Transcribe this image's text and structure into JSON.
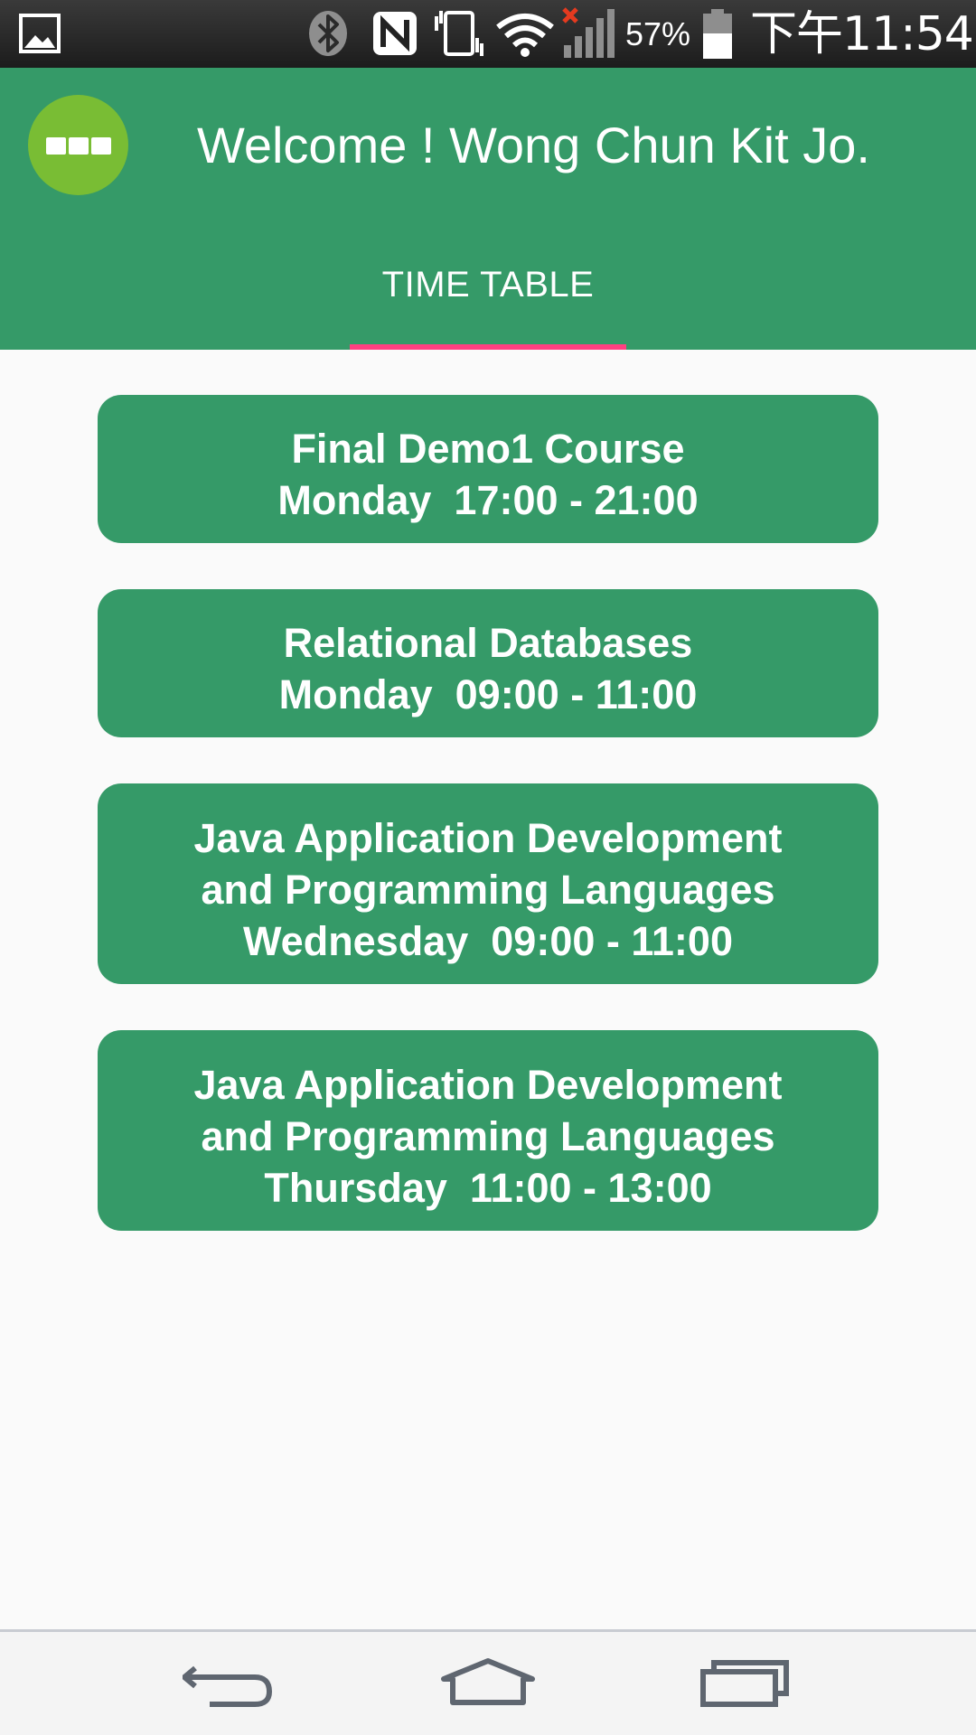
{
  "status_bar": {
    "battery_percent": "57%",
    "battery_level": 0.57,
    "time": "下午11:54",
    "icons": [
      "gallery-icon",
      "bluetooth-icon",
      "nfc-icon",
      "vibrate-icon",
      "wifi-icon",
      "signal-no-sim-icon",
      "battery-icon"
    ],
    "alert_color": "#e53a1f"
  },
  "header": {
    "menu_icon": "more-icon",
    "title": "Welcome ! Wong Chun Kit Jo.",
    "tabs": [
      {
        "label": "TIME TABLE",
        "selected": true
      }
    ]
  },
  "courses": [
    {
      "lines": [
        "Final Demo1 Course",
        "Monday  17:00 - 21:00"
      ]
    },
    {
      "lines": [
        "Relational Databases",
        "Monday  09:00 - 11:00"
      ]
    },
    {
      "lines": [
        "Java Application Development",
        "and Programming Languages",
        "Wednesday  09:00 - 11:00"
      ]
    },
    {
      "lines": [
        "Java Application Development",
        "and Programming Languages",
        "Thursday  11:00 - 13:00"
      ]
    }
  ],
  "nav_bar": {
    "icons": [
      "back-icon",
      "home-icon",
      "recents-icon"
    ]
  },
  "colors": {
    "primary": "#359a68",
    "menu_button": "#79bd34",
    "tab_indicator": "#ff4081",
    "background": "#fafafa"
  }
}
